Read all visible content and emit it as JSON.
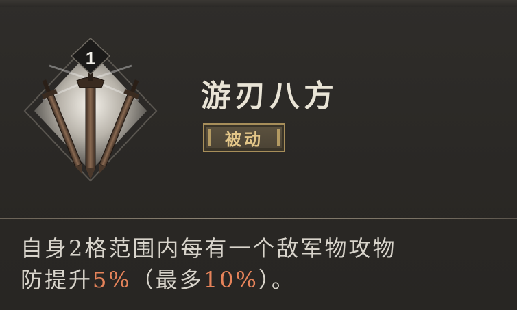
{
  "skill": {
    "level": "1",
    "name": "游刃八方",
    "type_label": "被动"
  },
  "description": {
    "line1": "自身2格范围内每有一个敌军物攻物",
    "line2_prefix": "防提升",
    "value1": "5%",
    "mid": "（最多",
    "value2": "10%",
    "suffix": "）。"
  },
  "colors": {
    "background": "#2a2826",
    "highlight": "#e6835a",
    "tag_text": "#e3c688",
    "name_text": "#e9e4d6"
  },
  "icons": [
    "three-swords-icon",
    "level-badge"
  ]
}
